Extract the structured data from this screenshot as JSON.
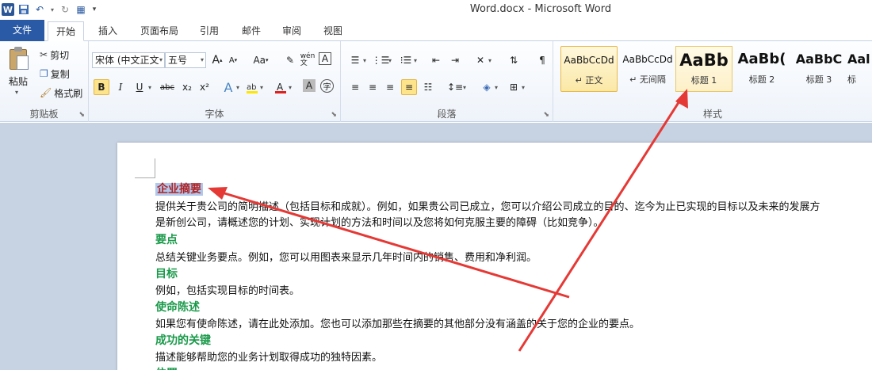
{
  "window": {
    "title": "Word.docx  -  Microsoft Word"
  },
  "tabs": [
    {
      "label": "文件"
    },
    {
      "label": "开始"
    },
    {
      "label": "插入"
    },
    {
      "label": "页面布局"
    },
    {
      "label": "引用"
    },
    {
      "label": "邮件"
    },
    {
      "label": "审阅"
    },
    {
      "label": "视图"
    }
  ],
  "clipboard": {
    "paste": "粘贴",
    "cut": "剪切",
    "copy": "复制",
    "format_painter": "格式刷",
    "label": "剪贴板"
  },
  "font": {
    "font_name": "宋体 (中文正文",
    "font_size": "五号",
    "grow": "A",
    "shrink": "A",
    "case": "Aa",
    "label": "字体",
    "bold": "B",
    "italic": "I",
    "underline": "U",
    "strike": "abc",
    "subscript": "x₂",
    "superscript": "x²"
  },
  "paragraph": {
    "label": "段落"
  },
  "styles": {
    "label": "样式",
    "items": [
      {
        "sample": "AaBbCcDd",
        "name": "↵ 正文"
      },
      {
        "sample": "AaBbCcDd",
        "name": "↵ 无间隔"
      },
      {
        "sample": "AaBb",
        "name": "标题 1"
      },
      {
        "sample": "AaBb(",
        "name": "标题 2"
      },
      {
        "sample": "AaBbC",
        "name": "标题 3"
      },
      {
        "sample": "Aal",
        "name": "标"
      }
    ]
  },
  "document": {
    "lines": [
      {
        "kind": "heading-selected",
        "text": "企业摘要"
      },
      {
        "kind": "body",
        "text": "提供关于贵公司的简明描述（包括目标和成就）。例如，如果贵公司已成立，您可以介绍公司成立的目的、迄今为止已实现的目标以及未来的发展方"
      },
      {
        "kind": "body",
        "text": "是新创公司，请概述您的计划、实现计划的方法和时间以及您将如何克服主要的障碍（比如竞争）。"
      },
      {
        "kind": "heading",
        "text": "要点"
      },
      {
        "kind": "body",
        "text": "总结关键业务要点。例如，您可以用图表来显示几年时间内的销售、费用和净利润。"
      },
      {
        "kind": "heading",
        "text": "目标"
      },
      {
        "kind": "body",
        "text": "例如，包括实现目标的时间表。"
      },
      {
        "kind": "heading",
        "text": "使命陈述"
      },
      {
        "kind": "body",
        "text": "如果您有使命陈述，请在此处添加。您也可以添加那些在摘要的其他部分没有涵盖的关于您的企业的要点。"
      },
      {
        "kind": "heading",
        "text": "成功的关键"
      },
      {
        "kind": "body",
        "text": "描述能够帮助您的业务计划取得成功的独特因素。"
      },
      {
        "kind": "heading",
        "text": "位置"
      }
    ]
  },
  "colors": {
    "accent": "#2a5aa5",
    "arrow": "#e53935",
    "heading": "#1a9a4a",
    "selected_heading": "#b22222"
  }
}
